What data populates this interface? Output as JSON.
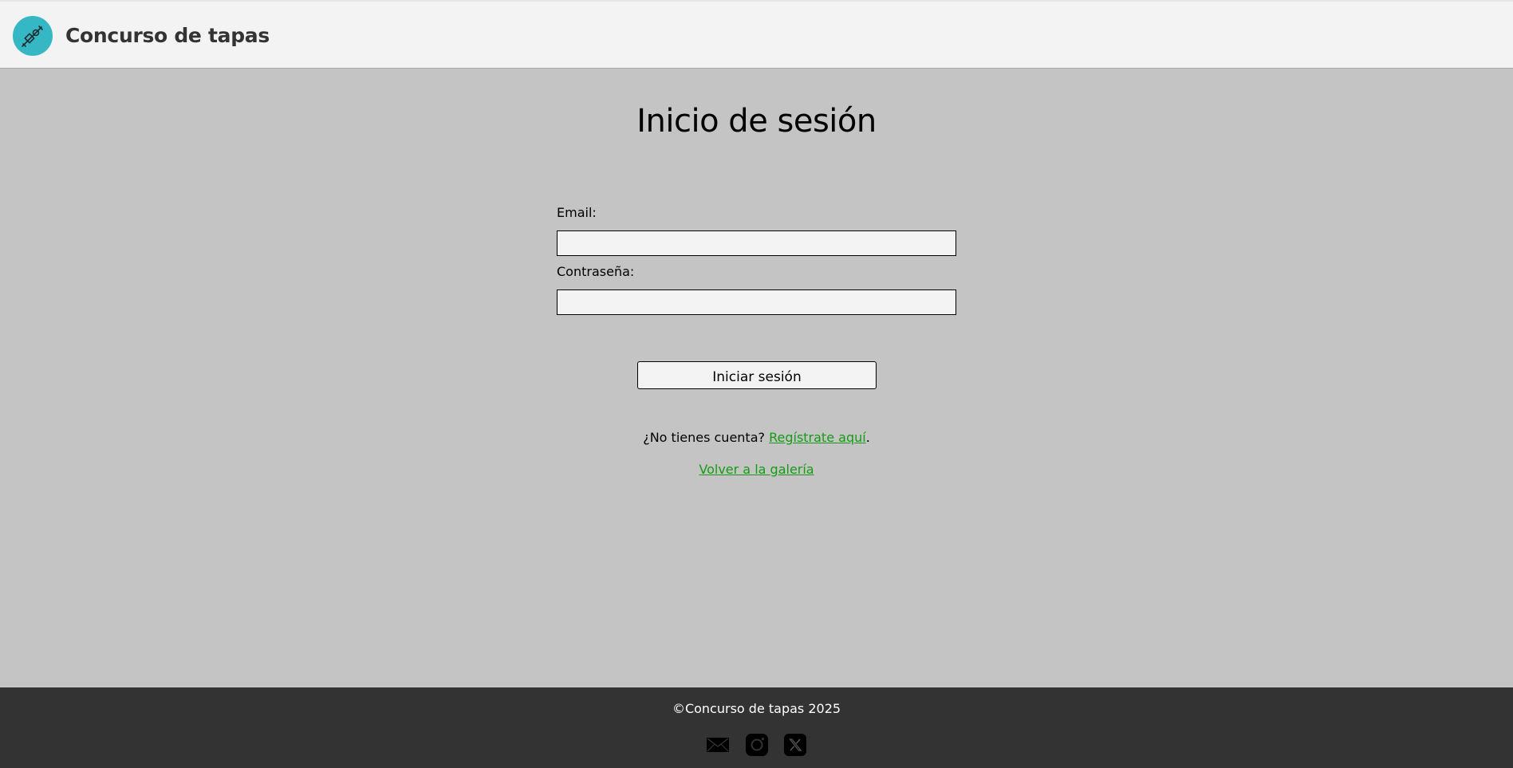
{
  "header": {
    "site_title": "Concurso de tapas",
    "logo_icon": "tapa-skewer-icon",
    "logo_color": "#36b8c4"
  },
  "main": {
    "heading": "Inicio de sesión",
    "form": {
      "email_label": "Email:",
      "email_value": "",
      "password_label": "Contraseña:",
      "password_value": "",
      "submit_label": "Iniciar sesión"
    },
    "register_prompt": "¿No tienes cuenta?",
    "register_link": "Regístrate aquí",
    "register_suffix": ".",
    "gallery_link": "Volver a la galería",
    "link_color": "#169b16"
  },
  "footer": {
    "copyright": "©Concurso de tapas 2025",
    "social": [
      {
        "icon": "mail-icon"
      },
      {
        "icon": "instagram-icon"
      },
      {
        "icon": "x-icon"
      }
    ]
  }
}
